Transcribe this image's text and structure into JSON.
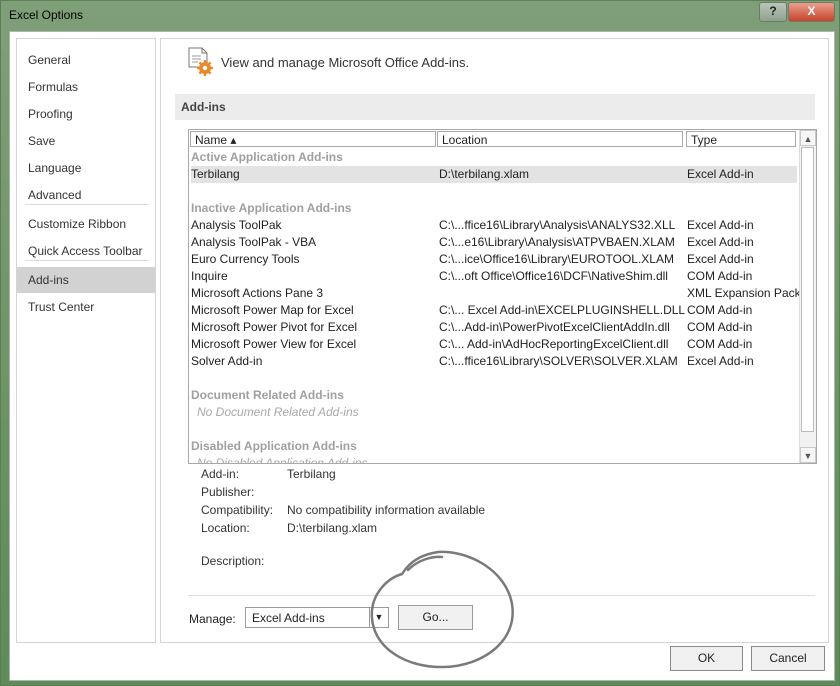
{
  "window": {
    "title": "Excel Options",
    "help_label": "?",
    "close_label": "X"
  },
  "sidebar": {
    "items": [
      {
        "label": "General"
      },
      {
        "label": "Formulas"
      },
      {
        "label": "Proofing"
      },
      {
        "label": "Save"
      },
      {
        "label": "Language"
      },
      {
        "label": "Advanced"
      },
      {
        "label": "Customize Ribbon"
      },
      {
        "label": "Quick Access Toolbar"
      },
      {
        "label": "Add-ins"
      },
      {
        "label": "Trust Center"
      }
    ],
    "active": "Add-ins"
  },
  "header": {
    "text": "View and manage Microsoft Office Add-ins.",
    "icon": "addin-gear-icon"
  },
  "section": {
    "title": "Add-ins"
  },
  "grid": {
    "columns": [
      "Name ▴",
      "Location",
      "Type"
    ],
    "groups": {
      "active": "Active Application Add-ins",
      "inactive": "Inactive Application Add-ins",
      "document": "Document Related Add-ins",
      "document_empty": "No Document Related Add-ins",
      "disabled": "Disabled Application Add-ins",
      "disabled_empty": "No Disabled Application Add-ins"
    },
    "active_rows": [
      {
        "name": "Terbilang",
        "location": "D:\\terbilang.xlam",
        "type": "Excel Add-in"
      }
    ],
    "inactive_rows": [
      {
        "name": "Analysis ToolPak",
        "location": "C:\\...ffice16\\Library\\Analysis\\ANALYS32.XLL",
        "type": "Excel Add-in"
      },
      {
        "name": "Analysis ToolPak - VBA",
        "location": "C:\\...e16\\Library\\Analysis\\ATPVBAEN.XLAM",
        "type": "Excel Add-in"
      },
      {
        "name": "Euro Currency Tools",
        "location": "C:\\...ice\\Office16\\Library\\EUROTOOL.XLAM",
        "type": "Excel Add-in"
      },
      {
        "name": "Inquire",
        "location": "C:\\...oft Office\\Office16\\DCF\\NativeShim.dll",
        "type": "COM Add-in"
      },
      {
        "name": "Microsoft Actions Pane 3",
        "location": "",
        "type": "XML Expansion Pack"
      },
      {
        "name": "Microsoft Power Map for Excel",
        "location": "C:\\... Excel Add-in\\EXCELPLUGINSHELL.DLL",
        "type": "COM Add-in"
      },
      {
        "name": "Microsoft Power Pivot for Excel",
        "location": "C:\\...Add-in\\PowerPivotExcelClientAddIn.dll",
        "type": "COM Add-in"
      },
      {
        "name": "Microsoft Power View for Excel",
        "location": "C:\\... Add-in\\AdHocReportingExcelClient.dll",
        "type": "COM Add-in"
      },
      {
        "name": "Solver Add-in",
        "location": "C:\\...ffice16\\Library\\SOLVER\\SOLVER.XLAM",
        "type": "Excel Add-in"
      }
    ]
  },
  "details": {
    "addin_label": "Add-in:",
    "addin_value": "Terbilang",
    "publisher_label": "Publisher:",
    "publisher_value": "",
    "compat_label": "Compatibility:",
    "compat_value": "No compatibility information available",
    "location_label": "Location:",
    "location_value": "D:\\terbilang.xlam",
    "description_label": "Description:",
    "description_value": ""
  },
  "manage": {
    "label": "Manage:",
    "selected": "Excel Add-ins",
    "go_label": "Go..."
  },
  "footer": {
    "ok_label": "OK",
    "cancel_label": "Cancel"
  },
  "colors": {
    "accent_selected": "#d2d2d2",
    "group_text": "#a0a0a0",
    "circle_stroke": "#7a7a7a"
  }
}
